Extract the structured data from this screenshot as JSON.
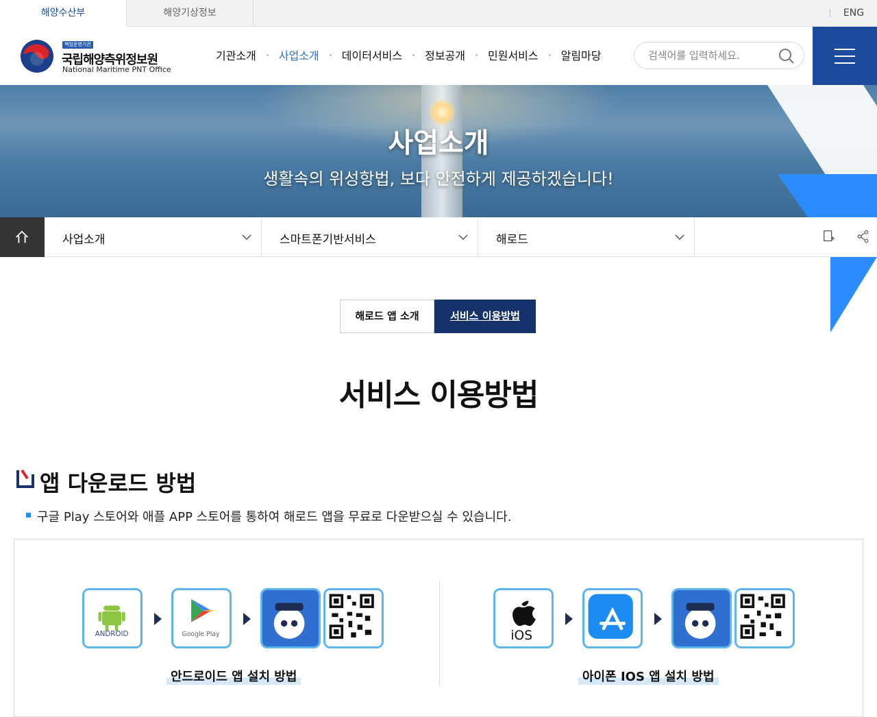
{
  "utility": {
    "tabs": [
      "해양수산부",
      "해양기상정보"
    ],
    "lang": "ENG"
  },
  "brand": {
    "badge": "책임운영기관",
    "name_ko": "국립해양측위정보원",
    "name_en": "National Maritime PNT Office"
  },
  "nav": {
    "items": [
      "기관소개",
      "사업소개",
      "데이터서비스",
      "정보공개",
      "민원서비스",
      "알림마당"
    ],
    "active": "사업소개"
  },
  "search": {
    "placeholder": "검색어를 입력하세요."
  },
  "hero": {
    "title": "사업소개",
    "subtitle": "생활속의 위성항법, 보다 안전하게 제공하겠습니다!"
  },
  "location": {
    "level1": "사업소개",
    "level2": "스마트폰기반서비스",
    "level3": "해로드"
  },
  "subtabs": [
    "해로드 앱 소개",
    "서비스 이용방법"
  ],
  "page_title": "서비스 이용방법",
  "section": {
    "title": "앱 다운로드 방법",
    "bullet": "구글 Play 스토어와 애플 APP 스토어를 통하여 해로드 앱을 무료로 다운받으실 수 있습니다."
  },
  "download": {
    "android_caption": "안드로이드 앱 설치 방법",
    "ios_caption": "아이폰 IOS 앱 설치 방법",
    "android_label": "ANDROID",
    "gplay_label": "Google Play",
    "ios_label": "iOS"
  },
  "colors": {
    "primary": "#1e4a9e",
    "accent": "#2a8cff",
    "tab_active": "#16326b"
  }
}
